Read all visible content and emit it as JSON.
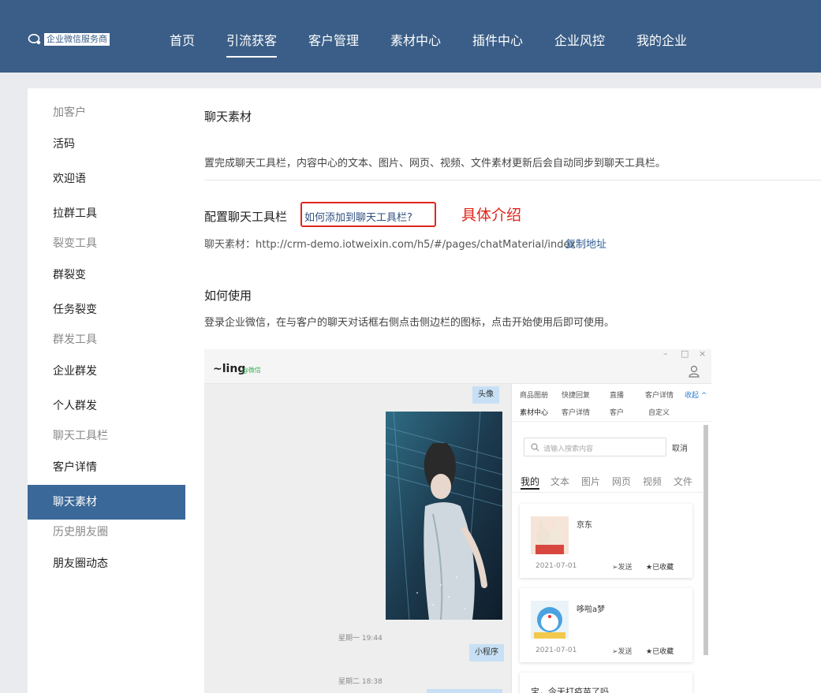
{
  "header": {
    "logo_text": "企业微信服务商",
    "nav": [
      "首页",
      "引流获客",
      "客户管理",
      "素材中心",
      "插件中心",
      "企业风控",
      "我的企业"
    ],
    "active_nav": "引流获客"
  },
  "sidebar": {
    "items": [
      {
        "label": "加客户",
        "kind": "group"
      },
      {
        "label": "活码",
        "kind": "link"
      },
      {
        "label": "欢迎语",
        "kind": "link"
      },
      {
        "label": "拉群工具",
        "kind": "link"
      },
      {
        "label": "裂变工具",
        "kind": "group"
      },
      {
        "label": "群裂变",
        "kind": "link"
      },
      {
        "label": "任务裂变",
        "kind": "link"
      },
      {
        "label": "群发工具",
        "kind": "group"
      },
      {
        "label": "企业群发",
        "kind": "link"
      },
      {
        "label": "个人群发",
        "kind": "link"
      },
      {
        "label": "聊天工具栏",
        "kind": "group"
      },
      {
        "label": "客户详情",
        "kind": "link"
      },
      {
        "label": "聊天素材",
        "kind": "active"
      },
      {
        "label": "历史朋友圈",
        "kind": "group"
      },
      {
        "label": "朋友圈动态",
        "kind": "link"
      }
    ]
  },
  "main": {
    "title": "聊天素材",
    "description": "置完成聊天工具栏，内容中心的文本、图片、网页、视频、文件素材更新后会自动同步到聊天工具栏。",
    "config_title": "配置聊天工具栏",
    "config_link": "如何添加到聊天工具栏?",
    "annotation": "具体介绍",
    "material_label": "聊天素材：http://crm-demo.iotweixin.com/h5/#/pages/chatMaterial/index",
    "copy_link": "复制地址",
    "howto_title": "如何使用",
    "howto_desc": "登录企业微信，在与客户的聊天对话框右侧点击侧边栏的图标，点击开始使用后即可使用。"
  },
  "screenshot": {
    "chat_name": "~ling",
    "chat_source": "@微信",
    "avatar_bubble": "头像",
    "time1": "星期一 19:44",
    "mini_bubble": "小程序",
    "time2": "星期二 18:38",
    "panel_tabs_row1": [
      "商品图册",
      "快捷回复",
      "直播",
      "客户详情",
      "收起 ^"
    ],
    "panel_tabs_row2": [
      "素材中心",
      "客户详情",
      "客户",
      "自定义"
    ],
    "search_placeholder": "请输入搜索内容",
    "cancel": "取消",
    "content_tabs": [
      "我的",
      "文本",
      "图片",
      "网页",
      "视频",
      "文件"
    ],
    "cards": [
      {
        "title": "京东",
        "date": "2021-07-01",
        "send": "发送",
        "fav": "已收藏"
      },
      {
        "title": "哆啦a梦",
        "date": "2021-07-01",
        "send": "发送",
        "fav": "已收藏"
      },
      {
        "title": "宝，今天打疫苗了吗",
        "date": "",
        "send": "",
        "fav": ""
      }
    ]
  }
}
